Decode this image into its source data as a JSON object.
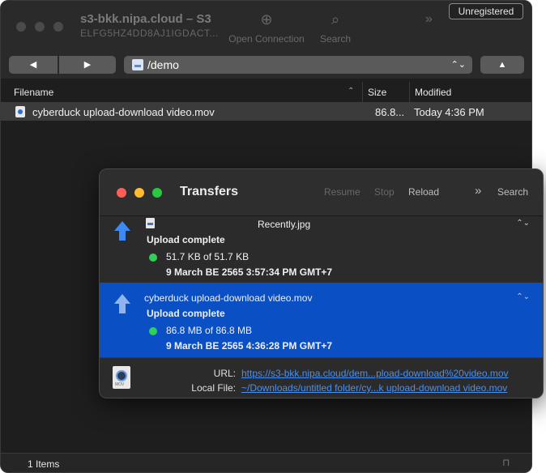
{
  "main_window": {
    "title": "s3-bkk.nipa.cloud – S3",
    "subtitle": "ELFG5HZ4DD8AJ1IGDACT...",
    "toolbar": {
      "open_connection": "Open Connection",
      "search": "Search",
      "more": "»"
    },
    "unregistered": "Unregistered",
    "nav": {
      "back": "◀",
      "forward": "▶",
      "path": "/demo",
      "path_chevron": "⌃⌄",
      "up": "▲"
    },
    "columns": {
      "filename": "Filename",
      "sort_indicator": "⌃",
      "size": "Size",
      "modified": "Modified"
    },
    "files": [
      {
        "name": "cyberduck upload-download video.mov",
        "size": "86.8...",
        "modified": "Today 4:36 PM"
      }
    ],
    "status": {
      "count": "1 Items",
      "lock": "🔒"
    }
  },
  "transfers": {
    "title": "Transfers",
    "toolbar": {
      "resume": "Resume",
      "stop": "Stop",
      "reload": "Reload",
      "more": "»",
      "search": "Search"
    },
    "items": [
      {
        "filename": "Recently.jpg",
        "status": "Upload complete",
        "bytes": "51.7 KB of 51.7 KB",
        "date": "9 March BE 2565 3:57:34 PM GMT+7",
        "chevron": "⌃⌄"
      },
      {
        "filename": "cyberduck upload-download video.mov",
        "status": "Upload complete",
        "bytes": "86.8 MB of 86.8 MB",
        "date": "9 March BE 2565 4:36:28 PM GMT+7",
        "chevron": "⌃⌄"
      }
    ],
    "footer": {
      "url_label": "URL:",
      "url_value": "https://s3-bkk.nipa.cloud/dem...pload-download%20video.mov",
      "local_label": "Local File:",
      "local_value": "~/Downloads/untitled folder/cy...k upload-download video.mov"
    }
  }
}
